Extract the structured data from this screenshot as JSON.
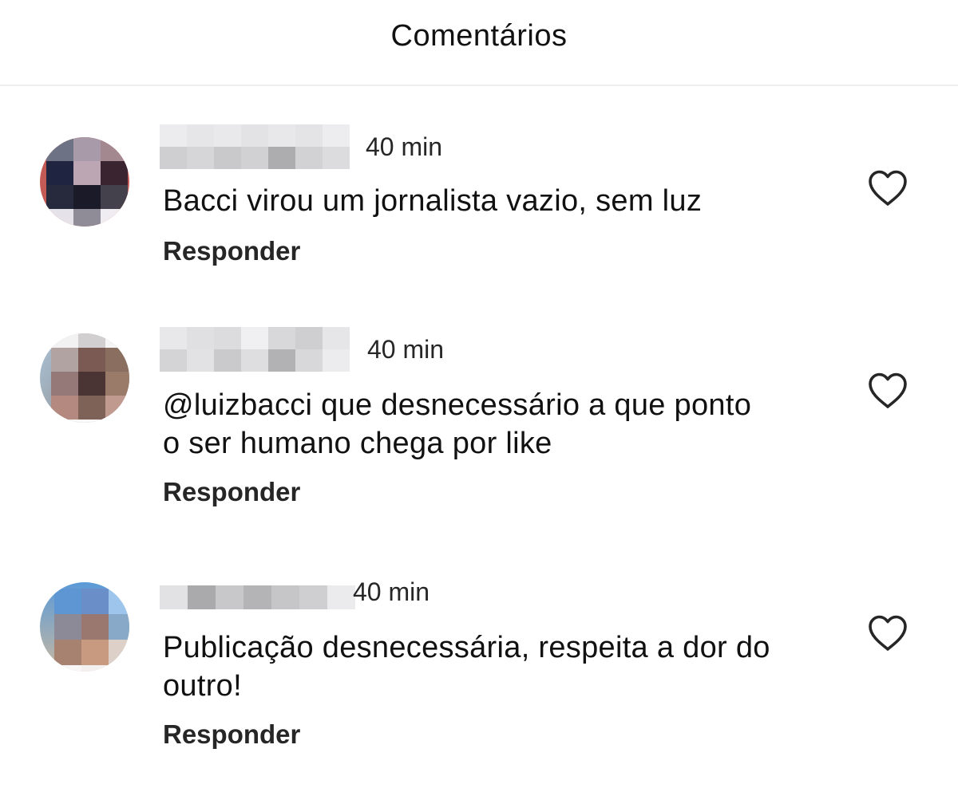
{
  "header": {
    "title": "Comentários"
  },
  "icons": {
    "like": "heart-outline-icon"
  },
  "comments": [
    {
      "username": "",
      "time": "40 min",
      "text": "Bacci virou um jornalista vazio, sem luz",
      "reply_label": "Responder"
    },
    {
      "username": "",
      "time": "40 min",
      "text": "@luizbacci que desnecessário a que ponto o ser humano chega por like",
      "reply_label": "Responder"
    },
    {
      "username": "",
      "time": "40 min",
      "text": "Publicação desnecessária, respeita a dor do outro!",
      "reply_label": "Responder"
    }
  ]
}
